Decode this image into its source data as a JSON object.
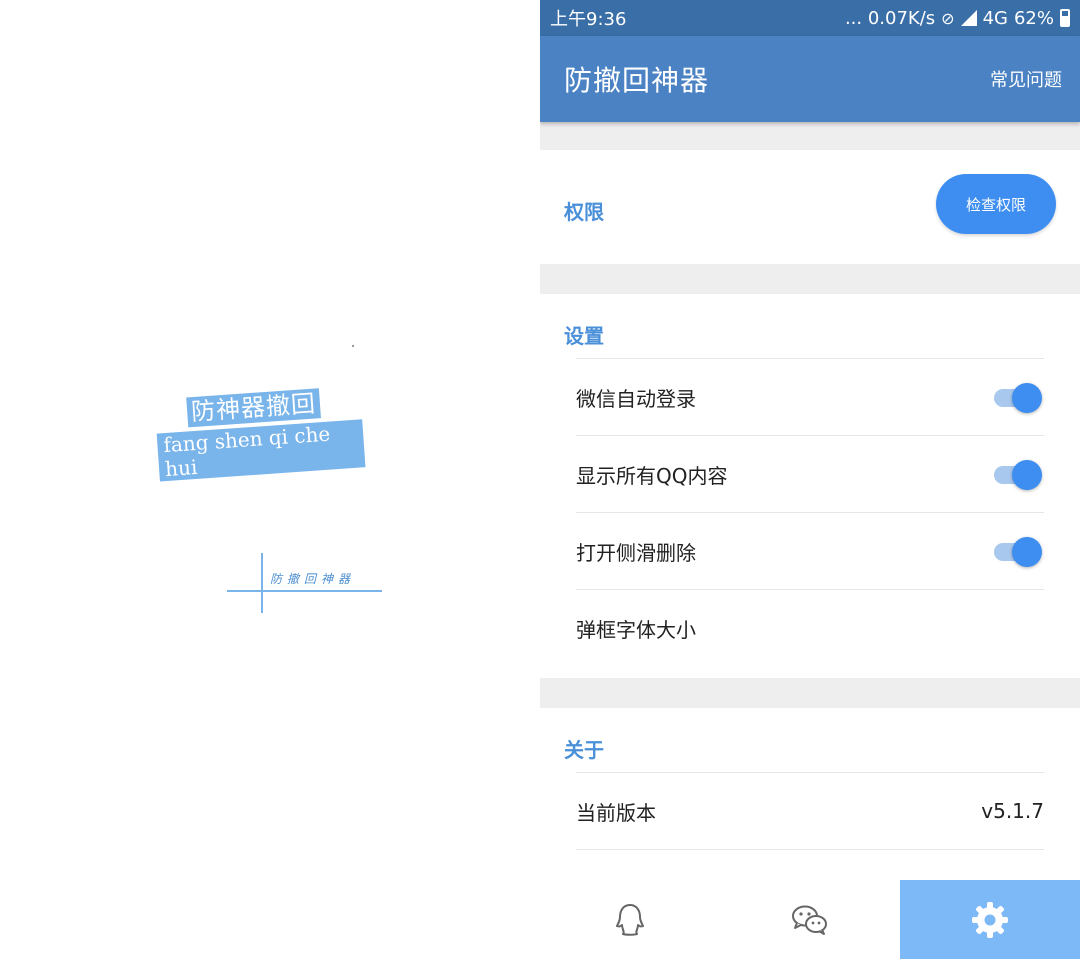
{
  "splash": {
    "logo_cn": "防神器撤回",
    "logo_pinyin": "fang shen qi che hui",
    "watermark": "防撤回神器"
  },
  "status_bar": {
    "time": "上午9:36",
    "network_speed": "... 0.07K/s",
    "network_type": "4G",
    "battery": "62%"
  },
  "app_bar": {
    "title": "防撤回神器",
    "faq_label": "常见问题"
  },
  "permissions": {
    "title": "权限",
    "check_button_label": "检查权限"
  },
  "settings": {
    "title": "设置",
    "items": [
      {
        "label": "微信自动登录",
        "enabled": true
      },
      {
        "label": "显示所有QQ内容",
        "enabled": true
      },
      {
        "label": "打开侧滑删除",
        "enabled": true
      },
      {
        "label": "弹框字体大小"
      }
    ]
  },
  "about": {
    "title": "关于",
    "version_label": "当前版本",
    "version_value": "v5.1.7"
  },
  "bottom_nav": {
    "tabs": [
      {
        "icon": "qq-icon",
        "active": false
      },
      {
        "icon": "wechat-icon",
        "active": false
      },
      {
        "icon": "gear-icon",
        "active": true
      }
    ]
  },
  "colors": {
    "status_bar": "#3a6ea7",
    "app_bar": "#4a82c3",
    "accent": "#3d8ef0",
    "section_title": "#4a90d9",
    "active_tab": "#7db8f7"
  }
}
